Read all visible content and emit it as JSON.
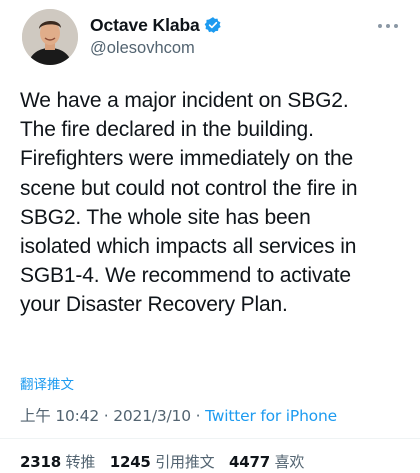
{
  "author": {
    "display_name": "Octave Klaba",
    "handle": "@olesovhcom",
    "verified": true,
    "avatar_icon": "profile-photo"
  },
  "tweet": {
    "lines": [
      "We have a major incident on SBG2.",
      "The fire declared in the building.",
      "Firefighters were immediately on the",
      "scene but could not control the fire in",
      "SBG2. The whole site has been",
      "isolated which impacts all services in",
      "SGB1-4. We recommend to activate",
      "your Disaster Recovery Plan."
    ],
    "translate_label": "翻译推文"
  },
  "meta": {
    "time": "上午 10:42",
    "separator": "·",
    "date": "2021/3/10",
    "source": "Twitter for iPhone"
  },
  "stats": {
    "retweets_count": "2318",
    "retweets_label": "转推",
    "quotes_count": "1245",
    "quotes_label": "引用推文",
    "likes_count": "4477",
    "likes_label": "喜欢"
  },
  "colors": {
    "accent": "#1d9bf0",
    "text": "#0f1419",
    "secondary": "#536471"
  }
}
